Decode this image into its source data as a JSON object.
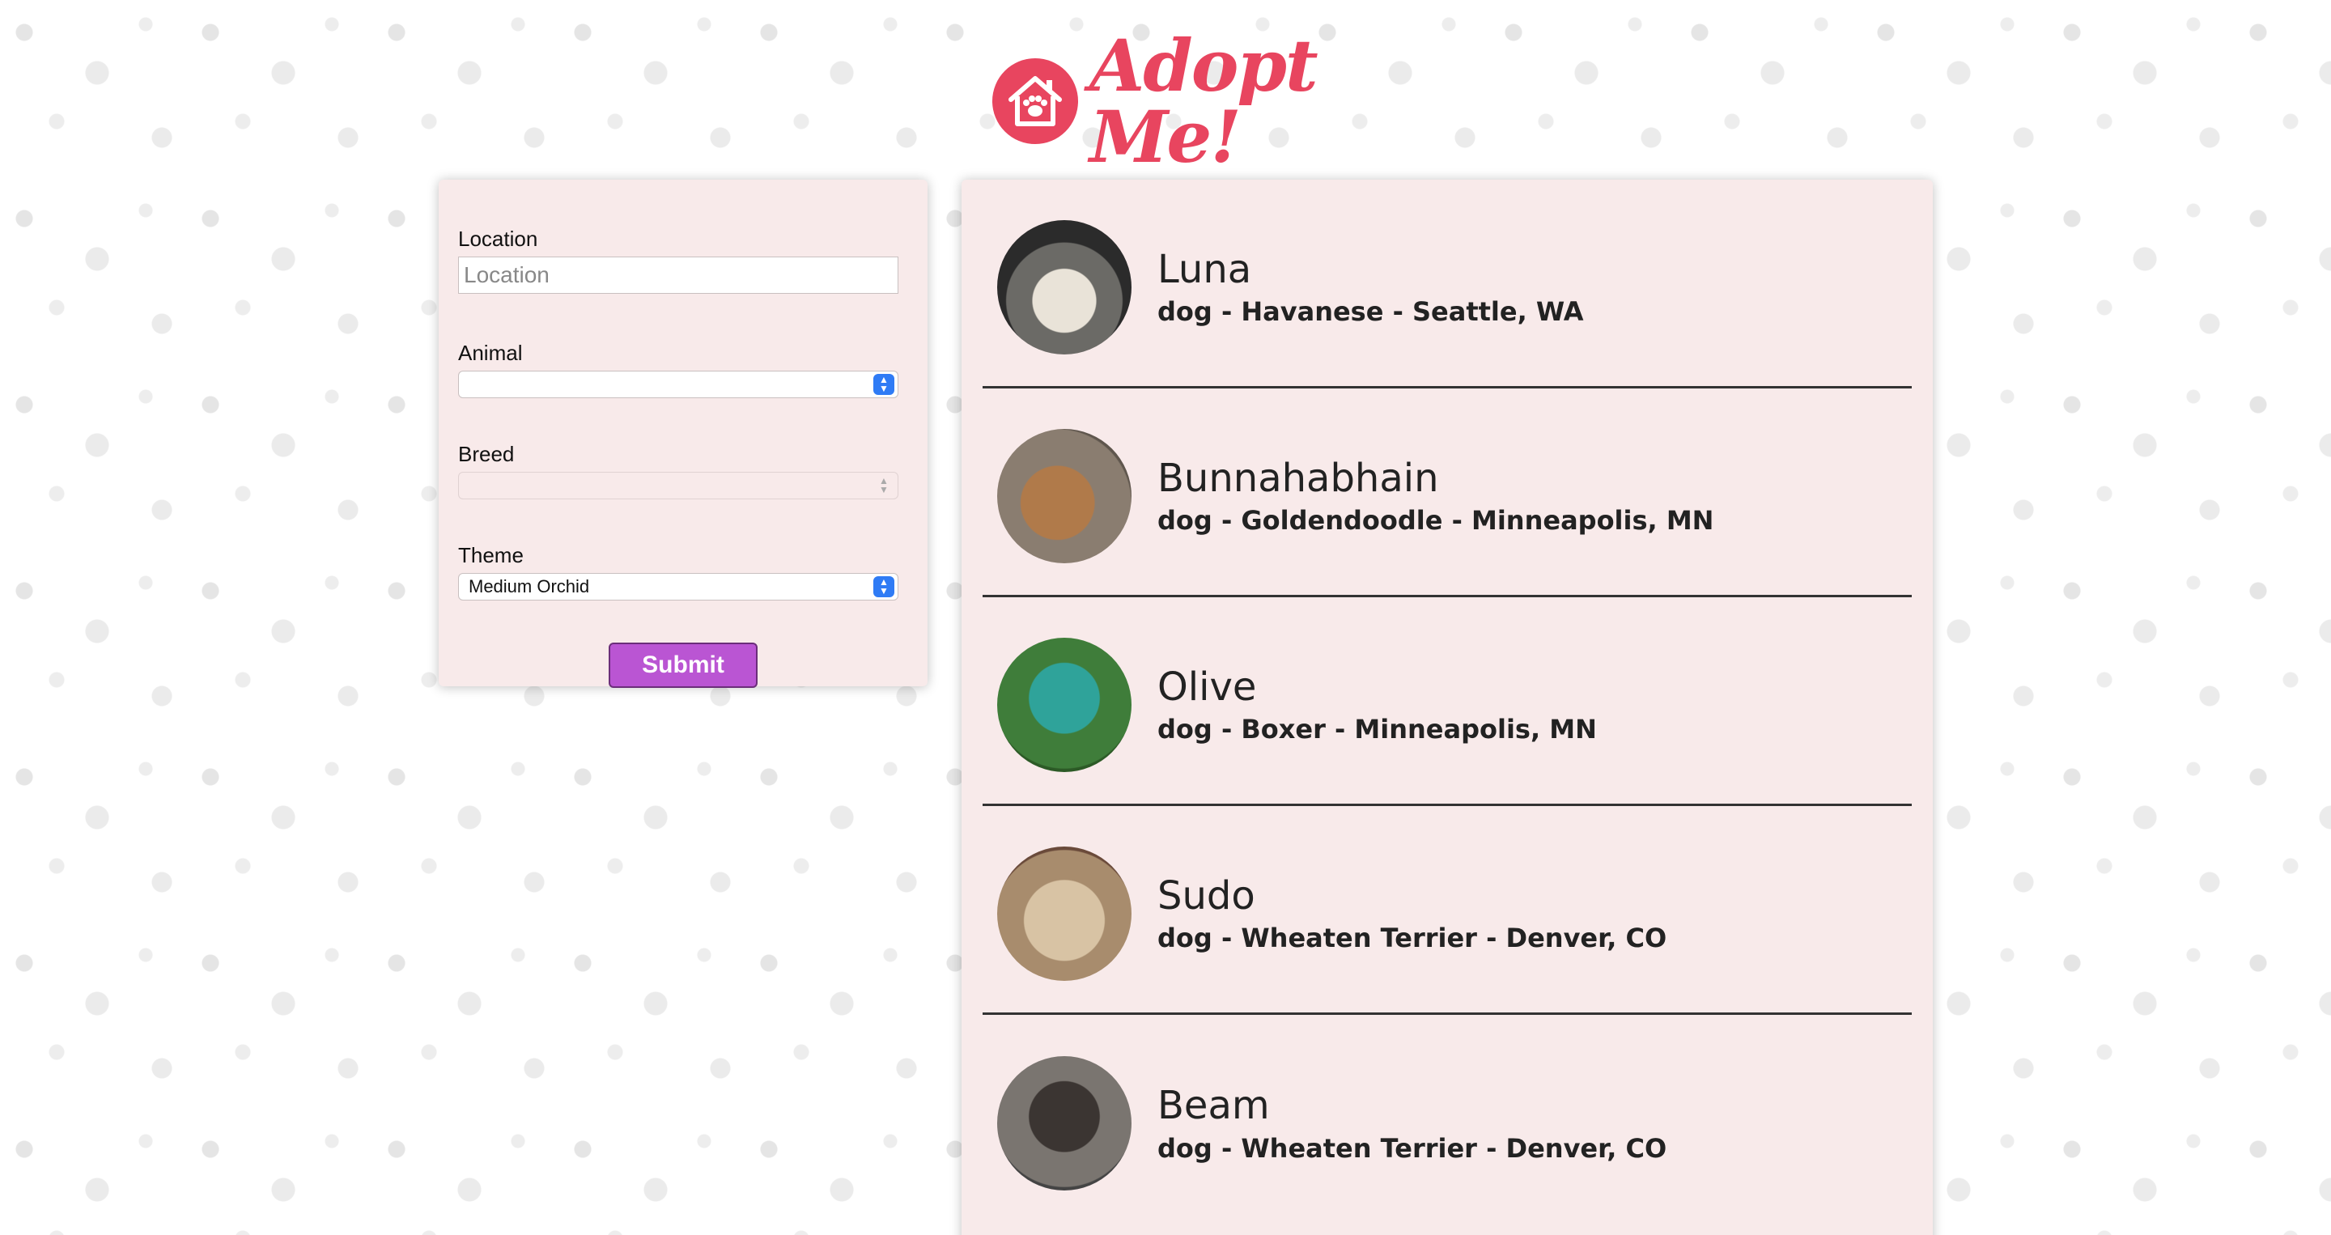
{
  "header": {
    "logo_text": "Adopt Me!",
    "logo_color": "#e8455f"
  },
  "search": {
    "location_label": "Location",
    "location_placeholder": "Location",
    "location_value": "",
    "animal_label": "Animal",
    "animal_value": "",
    "breed_label": "Breed",
    "breed_value": "",
    "theme_label": "Theme",
    "theme_value": "Medium Orchid",
    "submit_label": "Submit",
    "theme_color": "#ba55d3"
  },
  "pets": [
    {
      "name": "Luna",
      "description": "dog - Havanese - Seattle, WA"
    },
    {
      "name": "Bunnahabhain",
      "description": "dog - Goldendoodle - Minneapolis, MN"
    },
    {
      "name": "Olive",
      "description": "dog - Boxer - Minneapolis, MN"
    },
    {
      "name": "Sudo",
      "description": "dog - Wheaten Terrier - Denver, CO"
    },
    {
      "name": "Beam",
      "description": "dog - Wheaten Terrier - Denver, CO"
    }
  ]
}
